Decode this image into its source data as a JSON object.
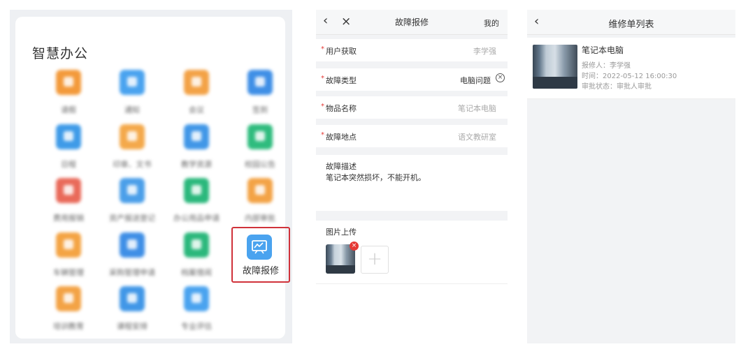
{
  "office": {
    "title": "智慧办公",
    "apps": [
      {
        "label": "请假",
        "color": "#f39a3b",
        "col": 0,
        "row": 0
      },
      {
        "label": "通知",
        "color": "#4aa3ef",
        "col": 1,
        "row": 0
      },
      {
        "label": "会议",
        "color": "#f3a246",
        "col": 2,
        "row": 0
      },
      {
        "label": "签到",
        "color": "#3f8fe6",
        "col": 3,
        "row": 0
      },
      {
        "label": "日程",
        "color": "#3f9be8",
        "col": 0,
        "row": 1
      },
      {
        "label": "印章、文书",
        "color": "#f4a94b",
        "col": 1,
        "row": 1
      },
      {
        "label": "教学资源",
        "color": "#4197e7",
        "col": 2,
        "row": 1
      },
      {
        "label": "校园公告",
        "color": "#2fbc7e",
        "col": 3,
        "row": 1
      },
      {
        "label": "费用报销",
        "color": "#e96a5a",
        "col": 0,
        "row": 2
      },
      {
        "label": "资产报送登记",
        "color": "#4b9fe9",
        "col": 1,
        "row": 2
      },
      {
        "label": "办公用品申请",
        "color": "#2bb87c",
        "col": 2,
        "row": 2
      },
      {
        "label": "内部审批",
        "color": "#f3a346",
        "col": 3,
        "row": 2
      },
      {
        "label": "车辆管理",
        "color": "#f4a444",
        "col": 0,
        "row": 3
      },
      {
        "label": "采购管理申请",
        "color": "#3f8fe6",
        "col": 1,
        "row": 3
      },
      {
        "label": "档案借阅",
        "color": "#2bb87c",
        "col": 2,
        "row": 3
      },
      {
        "label": "故障报修",
        "color": "#4aa3ef",
        "col": 3,
        "row": 3,
        "active": true
      },
      {
        "label": "培训教育",
        "color": "#f3a346",
        "col": 0,
        "row": 4
      },
      {
        "label": "课程安排",
        "color": "#4197e7",
        "col": 1,
        "row": 4
      },
      {
        "label": "专业评估",
        "color": "#4aa3ef",
        "col": 2,
        "row": 4
      }
    ]
  },
  "form": {
    "nav": {
      "back": "‹",
      "close": "×",
      "title": "故障报修",
      "mine": "我的"
    },
    "required_mark": "*",
    "fields": [
      {
        "label": "用户获取",
        "value": "李学强"
      },
      {
        "label": "故障类型",
        "value": "电脑问题"
      },
      {
        "label": "物品名称",
        "value": "笔记本电脑"
      },
      {
        "label": "故障地点",
        "value": "语文教研室"
      }
    ],
    "description": {
      "label": "故障描述",
      "value": "笔记本突然损坏，不能开机。"
    },
    "upload": {
      "label": "图片上传",
      "add": "+",
      "remove": "×"
    }
  },
  "list": {
    "nav": {
      "back": "‹",
      "title": "维修单列表"
    },
    "item": {
      "title": "笔记本电脑",
      "reporter": "报修人：李学强",
      "time": "时间：2022-05-12 16:00:30",
      "status": "审批状态：审批人审批"
    }
  }
}
